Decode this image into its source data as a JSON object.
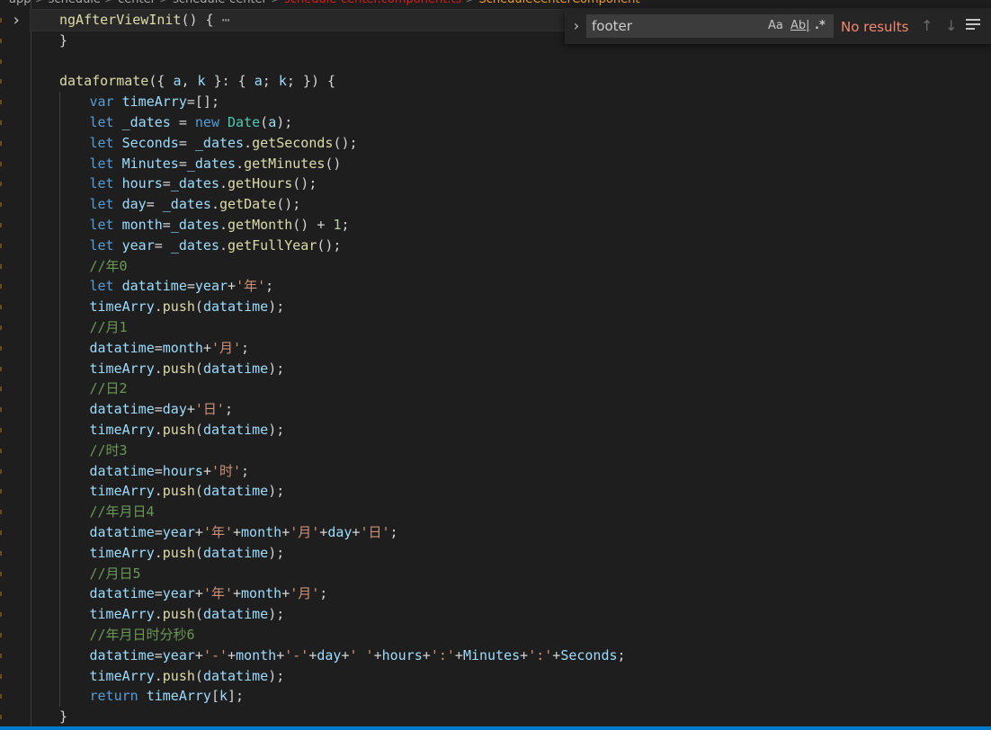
{
  "breadcrumb": {
    "items": [
      "app",
      "schedule",
      "center",
      "schedule-center",
      "schedule-center.component.ts",
      "ScheduleCenterComponent"
    ],
    "separator": ">"
  },
  "editor": {
    "lines": [
      [
        [
          "fn",
          "ngAfterViewInit"
        ],
        [
          "punc",
          "() { "
        ],
        [
          "ellipsis",
          "⋯"
        ]
      ],
      [
        [
          "punc",
          "}"
        ]
      ],
      [],
      [
        [
          "fn",
          "dataformate"
        ],
        [
          "punc",
          "({ "
        ],
        [
          "var",
          "a"
        ],
        [
          "punc",
          ", "
        ],
        [
          "var",
          "k"
        ],
        [
          "punc",
          " }: { "
        ],
        [
          "var",
          "a"
        ],
        [
          "punc",
          "; "
        ],
        [
          "var",
          "k"
        ],
        [
          "punc",
          "; }) {"
        ]
      ],
      [
        [
          "kw",
          "var"
        ],
        [
          "punc",
          " "
        ],
        [
          "var",
          "timeArry"
        ],
        [
          "punc",
          "=[];"
        ]
      ],
      [
        [
          "kw",
          "let"
        ],
        [
          "punc",
          " "
        ],
        [
          "var",
          "_dates"
        ],
        [
          "punc",
          " = "
        ],
        [
          "kw",
          "new"
        ],
        [
          "punc",
          " "
        ],
        [
          "cls2",
          "Date"
        ],
        [
          "punc",
          "("
        ],
        [
          "var",
          "a"
        ],
        [
          "punc",
          ");"
        ]
      ],
      [
        [
          "kw",
          "let"
        ],
        [
          "punc",
          " "
        ],
        [
          "var",
          "Seconds"
        ],
        [
          "punc",
          "= "
        ],
        [
          "var",
          "_dates"
        ],
        [
          "punc",
          "."
        ],
        [
          "fn",
          "getSeconds"
        ],
        [
          "punc",
          "();"
        ]
      ],
      [
        [
          "kw",
          "let"
        ],
        [
          "punc",
          " "
        ],
        [
          "var",
          "Minutes"
        ],
        [
          "punc",
          "="
        ],
        [
          "var",
          "_dates"
        ],
        [
          "punc",
          "."
        ],
        [
          "fn",
          "getMinutes"
        ],
        [
          "punc",
          "()"
        ]
      ],
      [
        [
          "kw",
          "let"
        ],
        [
          "punc",
          " "
        ],
        [
          "var",
          "hours"
        ],
        [
          "punc",
          "="
        ],
        [
          "var",
          "_dates"
        ],
        [
          "punc",
          "."
        ],
        [
          "fn",
          "getHours"
        ],
        [
          "punc",
          "();"
        ]
      ],
      [
        [
          "kw",
          "let"
        ],
        [
          "punc",
          " "
        ],
        [
          "var",
          "day"
        ],
        [
          "punc",
          "= "
        ],
        [
          "var",
          "_dates"
        ],
        [
          "punc",
          "."
        ],
        [
          "fn",
          "getDate"
        ],
        [
          "punc",
          "();"
        ]
      ],
      [
        [
          "kw",
          "let"
        ],
        [
          "punc",
          " "
        ],
        [
          "var",
          "month"
        ],
        [
          "punc",
          "="
        ],
        [
          "var",
          "_dates"
        ],
        [
          "punc",
          "."
        ],
        [
          "fn",
          "getMonth"
        ],
        [
          "punc",
          "() + "
        ],
        [
          "num",
          "1"
        ],
        [
          "punc",
          ";"
        ]
      ],
      [
        [
          "kw",
          "let"
        ],
        [
          "punc",
          " "
        ],
        [
          "var",
          "year"
        ],
        [
          "punc",
          "= "
        ],
        [
          "var",
          "_dates"
        ],
        [
          "punc",
          "."
        ],
        [
          "fn",
          "getFullYear"
        ],
        [
          "punc",
          "();"
        ]
      ],
      [
        [
          "cmt",
          "//年0"
        ]
      ],
      [
        [
          "kw",
          "let"
        ],
        [
          "punc",
          " "
        ],
        [
          "var",
          "datatime"
        ],
        [
          "punc",
          "="
        ],
        [
          "var",
          "year"
        ],
        [
          "punc",
          "+"
        ],
        [
          "str",
          "'年'"
        ],
        [
          "punc",
          ";"
        ]
      ],
      [
        [
          "var",
          "timeArry"
        ],
        [
          "punc",
          "."
        ],
        [
          "fn",
          "push"
        ],
        [
          "punc",
          "("
        ],
        [
          "var",
          "datatime"
        ],
        [
          "punc",
          ");"
        ]
      ],
      [
        [
          "cmt",
          "//月1"
        ]
      ],
      [
        [
          "var",
          "datatime"
        ],
        [
          "punc",
          "="
        ],
        [
          "var",
          "month"
        ],
        [
          "punc",
          "+"
        ],
        [
          "str",
          "'月'"
        ],
        [
          "punc",
          ";"
        ]
      ],
      [
        [
          "var",
          "timeArry"
        ],
        [
          "punc",
          "."
        ],
        [
          "fn",
          "push"
        ],
        [
          "punc",
          "("
        ],
        [
          "var",
          "datatime"
        ],
        [
          "punc",
          ");"
        ]
      ],
      [
        [
          "cmt",
          "//日2"
        ]
      ],
      [
        [
          "var",
          "datatime"
        ],
        [
          "punc",
          "="
        ],
        [
          "var",
          "day"
        ],
        [
          "punc",
          "+"
        ],
        [
          "str",
          "'日'"
        ],
        [
          "punc",
          ";"
        ]
      ],
      [
        [
          "var",
          "timeArry"
        ],
        [
          "punc",
          "."
        ],
        [
          "fn",
          "push"
        ],
        [
          "punc",
          "("
        ],
        [
          "var",
          "datatime"
        ],
        [
          "punc",
          ");"
        ]
      ],
      [
        [
          "cmt",
          "//时3"
        ]
      ],
      [
        [
          "var",
          "datatime"
        ],
        [
          "punc",
          "="
        ],
        [
          "var",
          "hours"
        ],
        [
          "punc",
          "+"
        ],
        [
          "str",
          "'时'"
        ],
        [
          "punc",
          ";"
        ]
      ],
      [
        [
          "var",
          "timeArry"
        ],
        [
          "punc",
          "."
        ],
        [
          "fn",
          "push"
        ],
        [
          "punc",
          "("
        ],
        [
          "var",
          "datatime"
        ],
        [
          "punc",
          ");"
        ]
      ],
      [
        [
          "cmt",
          "//年月日4"
        ]
      ],
      [
        [
          "var",
          "datatime"
        ],
        [
          "punc",
          "="
        ],
        [
          "var",
          "year"
        ],
        [
          "punc",
          "+"
        ],
        [
          "str",
          "'年'"
        ],
        [
          "punc",
          "+"
        ],
        [
          "var",
          "month"
        ],
        [
          "punc",
          "+"
        ],
        [
          "str",
          "'月'"
        ],
        [
          "punc",
          "+"
        ],
        [
          "var",
          "day"
        ],
        [
          "punc",
          "+"
        ],
        [
          "str",
          "'日'"
        ],
        [
          "punc",
          ";"
        ]
      ],
      [
        [
          "var",
          "timeArry"
        ],
        [
          "punc",
          "."
        ],
        [
          "fn",
          "push"
        ],
        [
          "punc",
          "("
        ],
        [
          "var",
          "datatime"
        ],
        [
          "punc",
          ");"
        ]
      ],
      [
        [
          "cmt",
          "//月日5"
        ]
      ],
      [
        [
          "var",
          "datatime"
        ],
        [
          "punc",
          "="
        ],
        [
          "var",
          "year"
        ],
        [
          "punc",
          "+"
        ],
        [
          "str",
          "'年'"
        ],
        [
          "punc",
          "+"
        ],
        [
          "var",
          "month"
        ],
        [
          "punc",
          "+"
        ],
        [
          "str",
          "'月'"
        ],
        [
          "punc",
          ";"
        ]
      ],
      [
        [
          "var",
          "timeArry"
        ],
        [
          "punc",
          "."
        ],
        [
          "fn",
          "push"
        ],
        [
          "punc",
          "("
        ],
        [
          "var",
          "datatime"
        ],
        [
          "punc",
          ");"
        ]
      ],
      [
        [
          "cmt",
          "//年月日时分秒6"
        ]
      ],
      [
        [
          "var",
          "datatime"
        ],
        [
          "punc",
          "="
        ],
        [
          "var",
          "year"
        ],
        [
          "punc",
          "+"
        ],
        [
          "str",
          "'-'"
        ],
        [
          "punc",
          "+"
        ],
        [
          "var",
          "month"
        ],
        [
          "punc",
          "+"
        ],
        [
          "str",
          "'-'"
        ],
        [
          "punc",
          "+"
        ],
        [
          "var",
          "day"
        ],
        [
          "punc",
          "+"
        ],
        [
          "str",
          "' '"
        ],
        [
          "punc",
          "+"
        ],
        [
          "var",
          "hours"
        ],
        [
          "punc",
          "+"
        ],
        [
          "str",
          "':'"
        ],
        [
          "punc",
          "+"
        ],
        [
          "var",
          "Minutes"
        ],
        [
          "punc",
          "+"
        ],
        [
          "str",
          "':'"
        ],
        [
          "punc",
          "+"
        ],
        [
          "var",
          "Seconds"
        ],
        [
          "punc",
          ";"
        ]
      ],
      [
        [
          "var",
          "timeArry"
        ],
        [
          "punc",
          "."
        ],
        [
          "fn",
          "push"
        ],
        [
          "punc",
          "("
        ],
        [
          "var",
          "datatime"
        ],
        [
          "punc",
          ");"
        ]
      ],
      [
        [
          "kw",
          "return"
        ],
        [
          "punc",
          " "
        ],
        [
          "var",
          "timeArry"
        ],
        [
          "punc",
          "["
        ],
        [
          "var",
          "k"
        ],
        [
          "punc",
          "];"
        ]
      ],
      [
        [
          "punc",
          "}"
        ]
      ]
    ],
    "indent_levels": [
      1,
      1,
      0,
      1,
      2,
      2,
      2,
      2,
      2,
      2,
      2,
      2,
      2,
      2,
      2,
      2,
      2,
      2,
      2,
      2,
      2,
      2,
      2,
      2,
      2,
      2,
      2,
      2,
      2,
      2,
      2,
      2,
      2,
      2,
      1
    ]
  },
  "find_widget": {
    "query": "footer",
    "match_case_label": "Aa",
    "whole_word_label": "Ab̲l̲",
    "regex_label": ".*",
    "results_text": "No results",
    "results_color": "#f48771",
    "prev_icon": "arrow-up-icon",
    "next_icon": "arrow-down-icon",
    "selection_icon": "lines-icon"
  },
  "theme": {
    "background": "#1e1e1e",
    "accent": "#007acc"
  }
}
